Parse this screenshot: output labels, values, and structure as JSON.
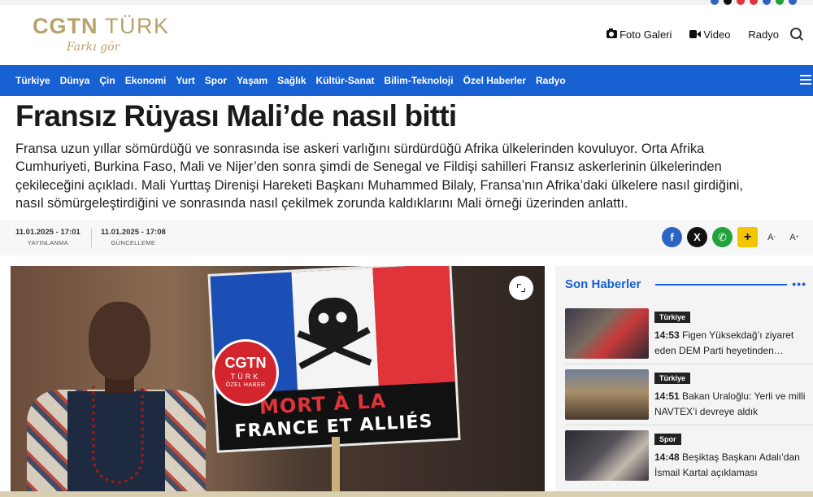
{
  "brand": {
    "name_main": "CGTN",
    "name_suffix": "TÜRK",
    "tagline": "Farkı gör",
    "gold_color": "#b9a26a",
    "accent_color": "#1761d3"
  },
  "header": {
    "links": [
      {
        "label": "Foto Galeri",
        "icon": "camera-icon"
      },
      {
        "label": "Video",
        "icon": "video-icon"
      },
      {
        "label": "Radyo",
        "icon": ""
      }
    ],
    "search_icon": "search-icon"
  },
  "nav": {
    "items": [
      "Türkiye",
      "Dünya",
      "Çin",
      "Ekonomi",
      "Yurt",
      "Spor",
      "Yaşam",
      "Sağlık",
      "Kültür-Sanat",
      "Bilim-Teknoloji",
      "Özel Haberler",
      "Radyo"
    ],
    "menu_icon": "hamburger-icon"
  },
  "article": {
    "title": "Fransız Rüyası Mali’de nasıl bitti",
    "summary_lines": [
      "Fransa uzun yıllar sömürdüğü ve sonrasında ise askeri varlığını sürdürdüğü Afrika ülkelerinden kovuluyor. Orta Afrika",
      "Cumhuriyeti, Burkina Faso, Mali ve Nijer’den sonra şimdi de Senegal ve Fildişi sahilleri Fransız askerlerinin ülkelerinden",
      "çekileceğini açıkladı. Mali Yurttaş Direnişi Hareketi Başkanı Muhammed Bilaly, Fransa’nın Afrika’daki ülkelere nasıl girdiğini,",
      "nasıl sömürgeleştirdiğini ve sonrasında nasıl çekilmek zorunda kaldıklarını Mali örneği üzerinden anlattı."
    ],
    "published_time": "11.01.2025 - 17:01",
    "published_label": "YAYINLANMA",
    "updated_time": "11.01.2025 - 17:08",
    "updated_label": "GÜNCELLEME",
    "share": {
      "facebook": "f",
      "x": "X",
      "whatsapp": "✆",
      "plus": "+",
      "font_down": "A",
      "font_down_sup": "-",
      "font_up": "A",
      "font_up_sup": "+"
    },
    "hero": {
      "badge_main": "CGTN",
      "badge_sub": "TÜRK",
      "badge_note": "ÖZEL HABER",
      "sign_line1": "MORT À LA",
      "sign_line2": "FRANCE ET ALLIÉS"
    }
  },
  "sidebar": {
    "heading": "Son Haberler",
    "more_icon": "•••",
    "items": [
      {
        "category": "Türkiye",
        "time": "14:53",
        "text": "Figen Yüksekdağ’ı ziyaret eden DEM Parti heyetinden…"
      },
      {
        "category": "Türkiye",
        "time": "14:51",
        "text": "Bakan Uraloğlu: Yerli ve milli NAVTEX’i devreye aldık"
      },
      {
        "category": "Spor",
        "time": "14:48",
        "text": "Beşiktaş Başkanı Adalı’dan İsmail Kartal açıklaması"
      }
    ]
  }
}
